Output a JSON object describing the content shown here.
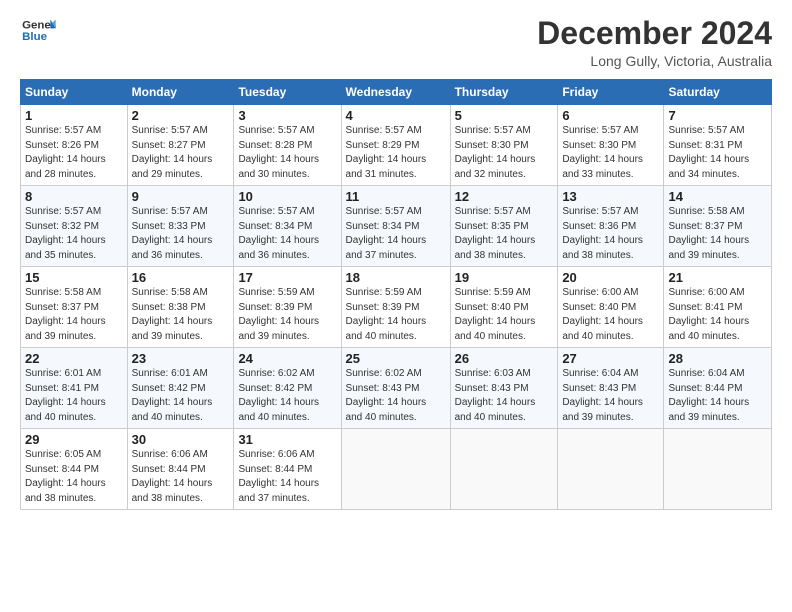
{
  "logo": {
    "line1": "General",
    "line2": "Blue"
  },
  "title": "December 2024",
  "location": "Long Gully, Victoria, Australia",
  "days_header": [
    "Sunday",
    "Monday",
    "Tuesday",
    "Wednesday",
    "Thursday",
    "Friday",
    "Saturday"
  ],
  "weeks": [
    [
      {
        "day": "1",
        "info": "Sunrise: 5:57 AM\nSunset: 8:26 PM\nDaylight: 14 hours\nand 28 minutes."
      },
      {
        "day": "2",
        "info": "Sunrise: 5:57 AM\nSunset: 8:27 PM\nDaylight: 14 hours\nand 29 minutes."
      },
      {
        "day": "3",
        "info": "Sunrise: 5:57 AM\nSunset: 8:28 PM\nDaylight: 14 hours\nand 30 minutes."
      },
      {
        "day": "4",
        "info": "Sunrise: 5:57 AM\nSunset: 8:29 PM\nDaylight: 14 hours\nand 31 minutes."
      },
      {
        "day": "5",
        "info": "Sunrise: 5:57 AM\nSunset: 8:30 PM\nDaylight: 14 hours\nand 32 minutes."
      },
      {
        "day": "6",
        "info": "Sunrise: 5:57 AM\nSunset: 8:30 PM\nDaylight: 14 hours\nand 33 minutes."
      },
      {
        "day": "7",
        "info": "Sunrise: 5:57 AM\nSunset: 8:31 PM\nDaylight: 14 hours\nand 34 minutes."
      }
    ],
    [
      {
        "day": "8",
        "info": "Sunrise: 5:57 AM\nSunset: 8:32 PM\nDaylight: 14 hours\nand 35 minutes."
      },
      {
        "day": "9",
        "info": "Sunrise: 5:57 AM\nSunset: 8:33 PM\nDaylight: 14 hours\nand 36 minutes."
      },
      {
        "day": "10",
        "info": "Sunrise: 5:57 AM\nSunset: 8:34 PM\nDaylight: 14 hours\nand 36 minutes."
      },
      {
        "day": "11",
        "info": "Sunrise: 5:57 AM\nSunset: 8:34 PM\nDaylight: 14 hours\nand 37 minutes."
      },
      {
        "day": "12",
        "info": "Sunrise: 5:57 AM\nSunset: 8:35 PM\nDaylight: 14 hours\nand 38 minutes."
      },
      {
        "day": "13",
        "info": "Sunrise: 5:57 AM\nSunset: 8:36 PM\nDaylight: 14 hours\nand 38 minutes."
      },
      {
        "day": "14",
        "info": "Sunrise: 5:58 AM\nSunset: 8:37 PM\nDaylight: 14 hours\nand 39 minutes."
      }
    ],
    [
      {
        "day": "15",
        "info": "Sunrise: 5:58 AM\nSunset: 8:37 PM\nDaylight: 14 hours\nand 39 minutes."
      },
      {
        "day": "16",
        "info": "Sunrise: 5:58 AM\nSunset: 8:38 PM\nDaylight: 14 hours\nand 39 minutes."
      },
      {
        "day": "17",
        "info": "Sunrise: 5:59 AM\nSunset: 8:39 PM\nDaylight: 14 hours\nand 39 minutes."
      },
      {
        "day": "18",
        "info": "Sunrise: 5:59 AM\nSunset: 8:39 PM\nDaylight: 14 hours\nand 40 minutes."
      },
      {
        "day": "19",
        "info": "Sunrise: 5:59 AM\nSunset: 8:40 PM\nDaylight: 14 hours\nand 40 minutes."
      },
      {
        "day": "20",
        "info": "Sunrise: 6:00 AM\nSunset: 8:40 PM\nDaylight: 14 hours\nand 40 minutes."
      },
      {
        "day": "21",
        "info": "Sunrise: 6:00 AM\nSunset: 8:41 PM\nDaylight: 14 hours\nand 40 minutes."
      }
    ],
    [
      {
        "day": "22",
        "info": "Sunrise: 6:01 AM\nSunset: 8:41 PM\nDaylight: 14 hours\nand 40 minutes."
      },
      {
        "day": "23",
        "info": "Sunrise: 6:01 AM\nSunset: 8:42 PM\nDaylight: 14 hours\nand 40 minutes."
      },
      {
        "day": "24",
        "info": "Sunrise: 6:02 AM\nSunset: 8:42 PM\nDaylight: 14 hours\nand 40 minutes."
      },
      {
        "day": "25",
        "info": "Sunrise: 6:02 AM\nSunset: 8:43 PM\nDaylight: 14 hours\nand 40 minutes."
      },
      {
        "day": "26",
        "info": "Sunrise: 6:03 AM\nSunset: 8:43 PM\nDaylight: 14 hours\nand 40 minutes."
      },
      {
        "day": "27",
        "info": "Sunrise: 6:04 AM\nSunset: 8:43 PM\nDaylight: 14 hours\nand 39 minutes."
      },
      {
        "day": "28",
        "info": "Sunrise: 6:04 AM\nSunset: 8:44 PM\nDaylight: 14 hours\nand 39 minutes."
      }
    ],
    [
      {
        "day": "29",
        "info": "Sunrise: 6:05 AM\nSunset: 8:44 PM\nDaylight: 14 hours\nand 38 minutes."
      },
      {
        "day": "30",
        "info": "Sunrise: 6:06 AM\nSunset: 8:44 PM\nDaylight: 14 hours\nand 38 minutes."
      },
      {
        "day": "31",
        "info": "Sunrise: 6:06 AM\nSunset: 8:44 PM\nDaylight: 14 hours\nand 37 minutes."
      },
      {
        "day": "",
        "info": ""
      },
      {
        "day": "",
        "info": ""
      },
      {
        "day": "",
        "info": ""
      },
      {
        "day": "",
        "info": ""
      }
    ]
  ]
}
